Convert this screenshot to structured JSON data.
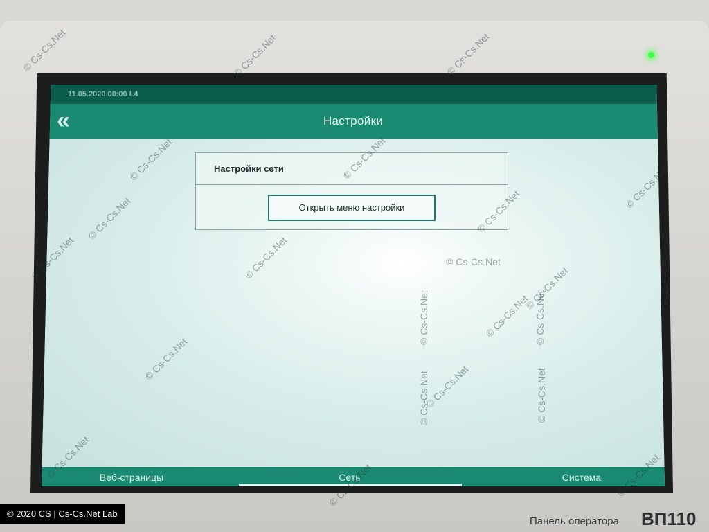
{
  "device": {
    "brand_text": "Панель оператора",
    "model_text": "ВП110"
  },
  "status_strip": {
    "text": "11.05.2020 00:00 L4"
  },
  "header": {
    "back_icon": "double-chevron-left-icon",
    "title": "Настройки"
  },
  "panel": {
    "title": "Настройки сети",
    "button_label": "Открыть меню настройки"
  },
  "nav": {
    "tabs": [
      "Веб-страницы",
      "Сеть",
      "Система"
    ],
    "active_index": 1
  },
  "watermark": {
    "text": "© Cs-Cs.Net",
    "badge": "© 2020 CS | Cs-Cs.Net Lab"
  },
  "colors": {
    "accent": "#1a8a72",
    "accent_dark": "#0b5e4e",
    "screen_bg": "#dbeeed"
  }
}
